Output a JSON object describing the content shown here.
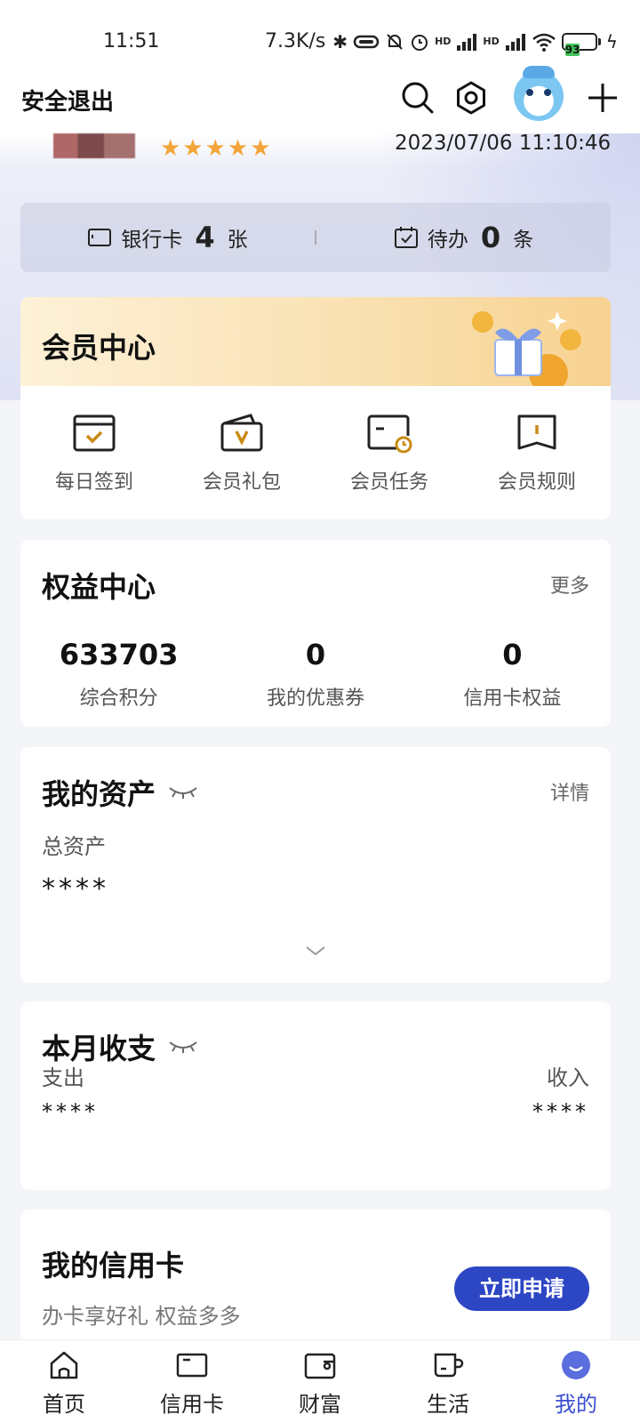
{
  "status_bar": {
    "time": "11:51",
    "net_speed": "7.3K/s",
    "battery": "93",
    "signal1": "HD",
    "signal2": "HD"
  },
  "header": {
    "logout_label": "安全退出"
  },
  "profile": {
    "stars": "★★★★★",
    "datetime": "2023/07/06 11:10:46"
  },
  "quick_bar": {
    "bank_label": "银行卡",
    "bank_count": "4",
    "bank_unit": "张",
    "todo_label": "待办",
    "todo_count": "0",
    "todo_unit": "条"
  },
  "member_center": {
    "title": "会员中心",
    "items": [
      {
        "label": "每日签到",
        "icon": "calendar-check-icon"
      },
      {
        "label": "会员礼包",
        "icon": "gift-bag-icon"
      },
      {
        "label": "会员任务",
        "icon": "task-clock-icon"
      },
      {
        "label": "会员规则",
        "icon": "rule-book-icon"
      }
    ]
  },
  "rights_center": {
    "title": "权益中心",
    "more": "更多",
    "stats": [
      {
        "value": "633703",
        "label": "综合积分"
      },
      {
        "value": "0",
        "label": "我的优惠券"
      },
      {
        "value": "0",
        "label": "信用卡权益"
      }
    ]
  },
  "assets": {
    "title": "我的资产",
    "detail": "详情",
    "total_label": "总资产",
    "total_value": "****"
  },
  "monthly": {
    "title": "本月收支",
    "expense_label": "支出",
    "expense_value": "****",
    "income_label": "收入",
    "income_value": "****"
  },
  "credit_card": {
    "title": "我的信用卡",
    "subtitle": "办卡享好礼 权益多多",
    "apply": "立即申请"
  },
  "tabs": [
    {
      "label": "首页",
      "icon": "home-icon"
    },
    {
      "label": "信用卡",
      "icon": "card-icon"
    },
    {
      "label": "财富",
      "icon": "wallet-icon"
    },
    {
      "label": "生活",
      "icon": "cup-icon"
    },
    {
      "label": "我的",
      "icon": "profile-icon"
    }
  ],
  "colors": {
    "accent": "#3b4fd0",
    "apply_button": "#2d46c4",
    "star": "#f3a53a",
    "member_icon": "#c98a14"
  }
}
